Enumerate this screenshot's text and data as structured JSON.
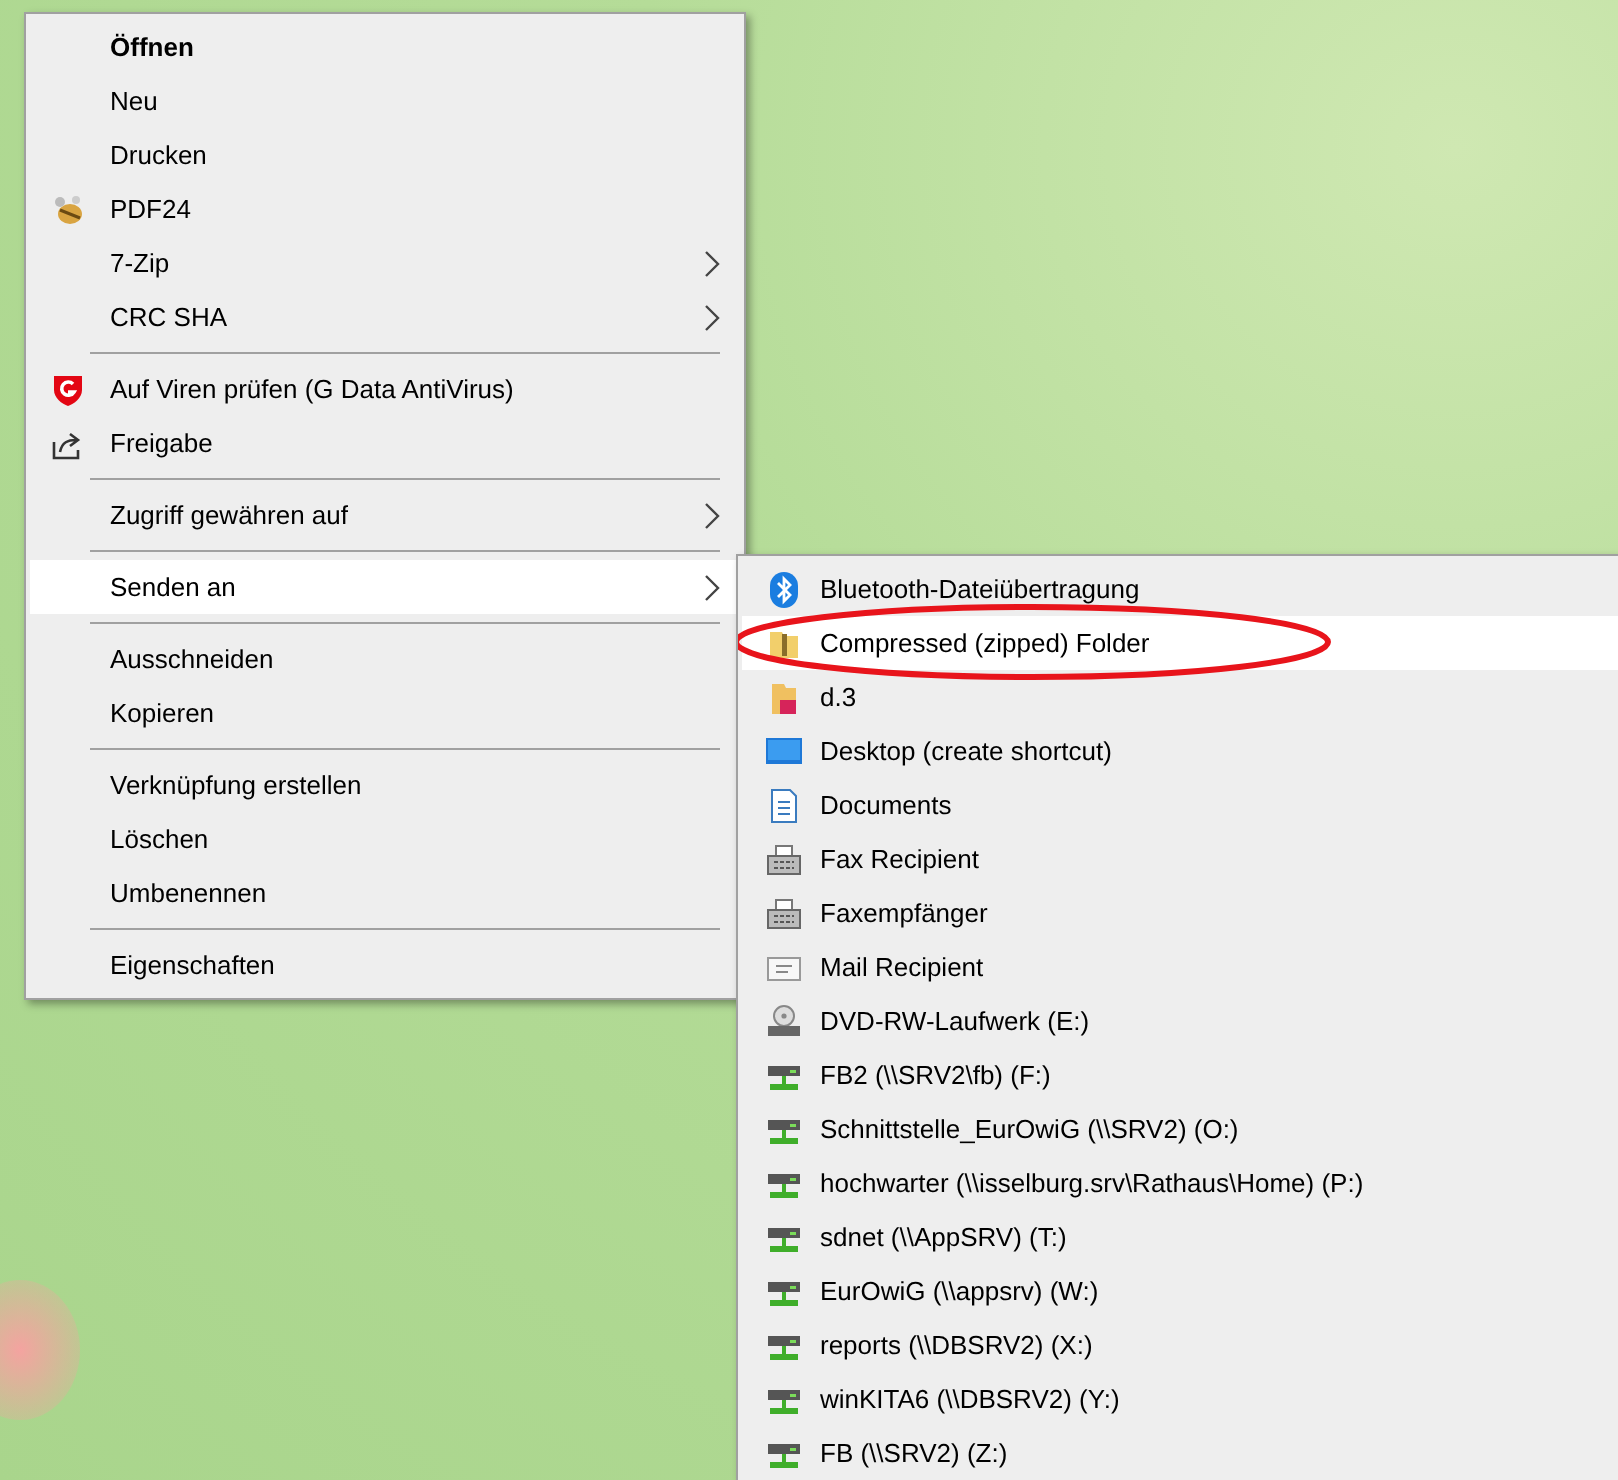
{
  "context_menu": {
    "items": [
      {
        "kind": "item",
        "label": "Öffnen",
        "bold": true,
        "submenu": false,
        "selected": false
      },
      {
        "kind": "item",
        "label": "Neu",
        "submenu": false,
        "selected": false
      },
      {
        "kind": "item",
        "label": "Drucken",
        "submenu": false,
        "selected": false
      },
      {
        "kind": "item",
        "label": "PDF24",
        "submenu": false,
        "selected": false
      },
      {
        "kind": "item",
        "label": "7-Zip",
        "submenu": true,
        "selected": false
      },
      {
        "kind": "item",
        "label": "CRC SHA",
        "submenu": true,
        "selected": false
      },
      {
        "kind": "separator"
      },
      {
        "kind": "item",
        "label": "Auf Viren prüfen (G Data AntiVirus)",
        "submenu": false,
        "selected": false
      },
      {
        "kind": "item",
        "label": "Freigabe",
        "submenu": false,
        "selected": false
      },
      {
        "kind": "separator"
      },
      {
        "kind": "item",
        "label": "Zugriff gewähren auf",
        "submenu": true,
        "selected": false
      },
      {
        "kind": "separator"
      },
      {
        "kind": "item",
        "label": "Senden an",
        "submenu": true,
        "selected": true
      },
      {
        "kind": "separator"
      },
      {
        "kind": "item",
        "label": "Ausschneiden",
        "submenu": false,
        "selected": false
      },
      {
        "kind": "item",
        "label": "Kopieren",
        "submenu": false,
        "selected": false
      },
      {
        "kind": "separator"
      },
      {
        "kind": "item",
        "label": "Verknüpfung erstellen",
        "submenu": false,
        "selected": false
      },
      {
        "kind": "item",
        "label": "Löschen",
        "submenu": false,
        "selected": false
      },
      {
        "kind": "item",
        "label": "Umbenennen",
        "submenu": false,
        "selected": false
      },
      {
        "kind": "separator"
      },
      {
        "kind": "item",
        "label": "Eigenschaften",
        "submenu": false,
        "selected": false
      }
    ]
  },
  "send_to_menu": {
    "items": [
      {
        "label": "Bluetooth-Dateiübertragung",
        "selected": false,
        "circled": false
      },
      {
        "label": "Compressed (zipped) Folder",
        "selected": true,
        "circled": true
      },
      {
        "label": "d.3",
        "selected": false,
        "circled": false
      },
      {
        "label": "Desktop (create shortcut)",
        "selected": false,
        "circled": false
      },
      {
        "label": "Documents",
        "selected": false,
        "circled": false
      },
      {
        "label": "Fax Recipient",
        "selected": false,
        "circled": false
      },
      {
        "label": "Faxempfänger",
        "selected": false,
        "circled": false
      },
      {
        "label": "Mail Recipient",
        "selected": false,
        "circled": false
      },
      {
        "label": "DVD-RW-Laufwerk (E:)",
        "selected": false,
        "circled": false
      },
      {
        "label": "FB2 (\\\\SRV2\\fb) (F:)",
        "selected": false,
        "circled": false
      },
      {
        "label": "Schnittstelle_EurOwiG (\\\\SRV2) (O:)",
        "selected": false,
        "circled": false
      },
      {
        "label": "hochwarter (\\\\isselburg.srv\\Rathaus\\Home) (P:)",
        "selected": false,
        "circled": false
      },
      {
        "label": "sdnet (\\\\AppSRV) (T:)",
        "selected": false,
        "circled": false
      },
      {
        "label": "EurOwiG (\\\\appsrv) (W:)",
        "selected": false,
        "circled": false
      },
      {
        "label": "reports (\\\\DBSRV2) (X:)",
        "selected": false,
        "circled": false
      },
      {
        "label": "winKITA6 (\\\\DBSRV2) (Y:)",
        "selected": false,
        "circled": false
      },
      {
        "label": "FB (\\\\SRV2) (Z:)",
        "selected": false,
        "circled": false
      }
    ]
  }
}
